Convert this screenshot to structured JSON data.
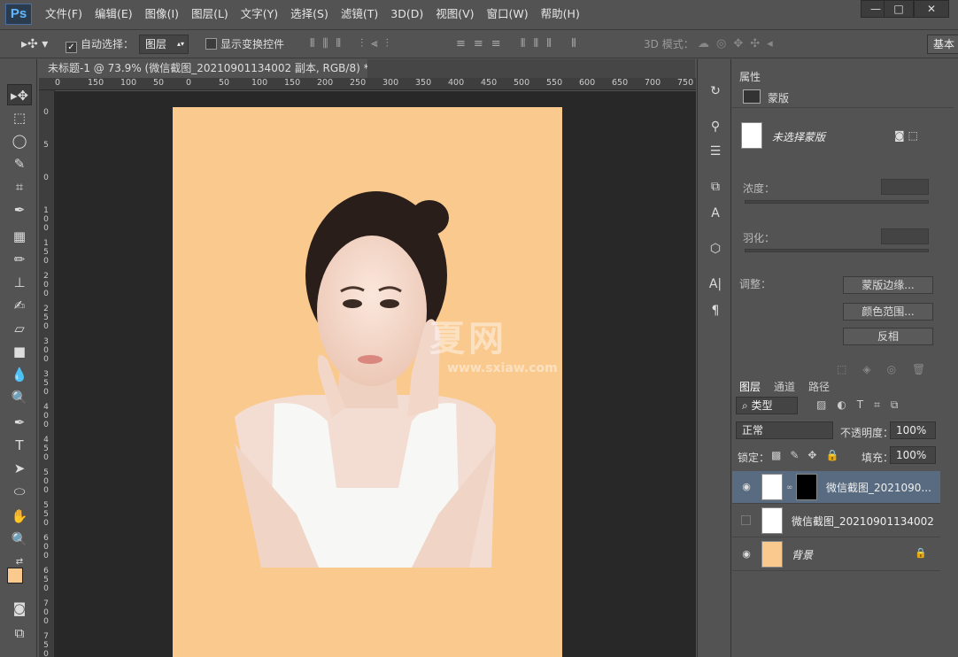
{
  "app": {
    "logo": "Ps"
  },
  "menu": [
    "文件(F)",
    "编辑(E)",
    "图像(I)",
    "图层(L)",
    "文字(Y)",
    "选择(S)",
    "滤镜(T)",
    "3D(D)",
    "视图(V)",
    "窗口(W)",
    "帮助(H)"
  ],
  "window_controls": {
    "minimize": "—",
    "restore": "□",
    "close": "✕"
  },
  "options_bar": {
    "auto_select_label": "自动选择：",
    "auto_select_checked": true,
    "auto_select_value": "图层",
    "show_transform_label": "显示变换控件",
    "mode_3d_label": "3D 模式：",
    "workspace": "基本"
  },
  "document": {
    "tab_title": "未标题-1 @ 73.9% (微信截图_20210901134002 副本, RGB/8) *",
    "close": "✕",
    "canvas_color": "#fac98e",
    "ruler_h": [
      "0",
      "150",
      "100",
      "50",
      "0",
      "50",
      "100",
      "150",
      "200",
      "250",
      "300",
      "350",
      "400",
      "450",
      "500",
      "550",
      "600",
      "650",
      "700",
      "750"
    ],
    "ruler_v": [
      "0",
      "5",
      "0",
      "1\n0\n0",
      "1\n5\n0",
      "2\n0\n0",
      "2\n5\n0",
      "3\n0\n0",
      "3\n5\n0",
      "4\n0\n0",
      "4\n5\n0",
      "5\n0\n0",
      "5\n5\n0",
      "6\n0\n0",
      "6\n5\n0",
      "7\n0\n0",
      "7\n5\n0"
    ],
    "watermark": "夏网",
    "watermark_url": "www.sxiaw.com"
  },
  "tools": [
    "move-tool",
    "marquee-tool",
    "lasso-tool",
    "quick-select-tool",
    "crop-tool",
    "eyedropper-tool",
    "healing-tool",
    "brush-tool",
    "stamp-tool",
    "history-brush-tool",
    "eraser-tool",
    "gradient-tool",
    "blur-tool",
    "dodge-tool",
    "pen-tool",
    "type-tool",
    "path-select-tool",
    "shape-tool",
    "hand-tool",
    "zoom-tool"
  ],
  "colors": {
    "foreground": "#fac98e",
    "background": "#ffffff"
  },
  "properties": {
    "tab": "属性",
    "section": "蒙版",
    "mask_status": "未选择蒙版",
    "density_label": "浓度：",
    "feather_label": "羽化：",
    "adjust_label": "调整：",
    "btn_mask_edge": "蒙版边缘...",
    "btn_color_range": "颜色范围...",
    "btn_invert": "反相"
  },
  "layers": {
    "tabs": [
      "图层",
      "通道",
      "路径"
    ],
    "filter": "类型",
    "blend_mode": "正常",
    "opacity_label": "不透明度：",
    "opacity": "100%",
    "lock_label": "锁定：",
    "fill_label": "填充：",
    "fill": "100%",
    "items": [
      {
        "name": "微信截图_2021090...",
        "visible": true,
        "selected": true
      },
      {
        "name": "微信截图_20210901134002",
        "visible": false,
        "selected": false
      },
      {
        "name": "背景",
        "visible": true,
        "selected": false
      }
    ]
  }
}
